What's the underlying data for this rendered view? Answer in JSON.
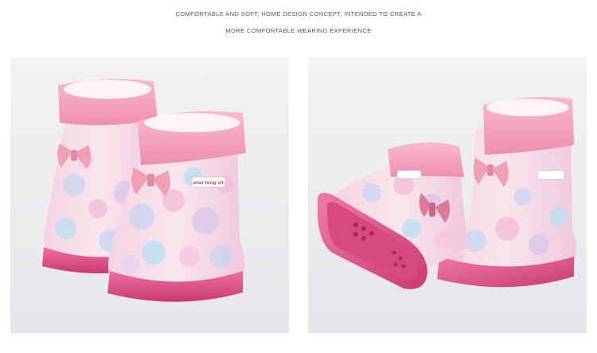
{
  "caption": {
    "line1": "COMFORTABLE AND SOFT, HOME DESIGN CONCEPT, INTENDED TO CREATE A",
    "line2": "MORE COMFORTABLE WEARING EXPERIENCE"
  },
  "photos": [
    {
      "name": "boots-front-view",
      "depicts": "pair of pink patterned rain boots with plush cuffs and bows"
    },
    {
      "name": "boots-sole-view",
      "depicts": "pink rain boots, one lying on its side showing the sole"
    }
  ],
  "brand_label": "zhai feng vlt",
  "colors": {
    "cuff_pink": "#f5a3bf",
    "sole_pink": "#e2528a",
    "bow_pink": "#efa0b5",
    "body_base": "#f3dce6"
  }
}
